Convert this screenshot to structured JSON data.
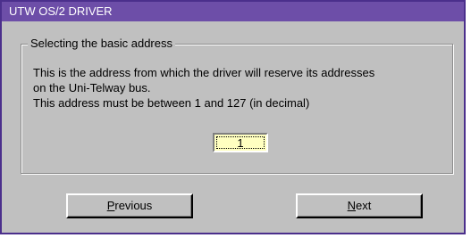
{
  "window": {
    "title": "UTW OS/2 DRIVER"
  },
  "group": {
    "legend": "Selecting the basic address",
    "description_lines": [
      "This is the address from which the driver will reserve its addresses",
      "on the Uni-Telway bus.",
      "This address must be between 1 and 127 (in decimal)"
    ]
  },
  "address_field": {
    "value": "1"
  },
  "buttons": {
    "previous": {
      "mnemonic": "P",
      "rest": "revious"
    },
    "next": {
      "mnemonic": "N",
      "rest": "ext"
    }
  },
  "colors": {
    "title_bar": "#6d4ea8",
    "frame_border": "#4b2f8c",
    "dialog_face": "#c0c0c0",
    "input_background": "#ffffc0"
  }
}
